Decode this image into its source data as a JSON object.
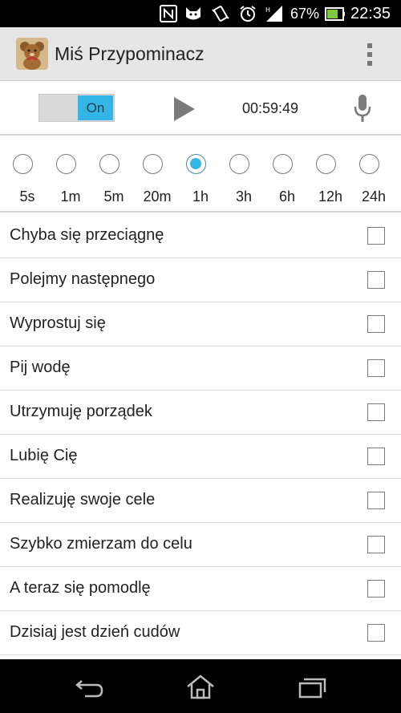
{
  "status_bar": {
    "battery_percent": "67%",
    "time": "22:35",
    "icons": [
      "nfc-icon",
      "cat-icon",
      "vibrate-icon",
      "alarm-icon",
      "signal-icon",
      "battery-icon"
    ]
  },
  "action_bar": {
    "title": "Miś Przypominacz",
    "app_icon": "teddy-bear-icon",
    "menu_icon": "overflow-menu-icon"
  },
  "controls": {
    "toggle_label": "On",
    "toggle_state": true,
    "timer": "00:59:49",
    "play_icon": "play-icon",
    "mic_icon": "microphone-icon"
  },
  "intervals": {
    "selected": "1h",
    "options": [
      {
        "label": "5s",
        "checked": false
      },
      {
        "label": "1m",
        "checked": false
      },
      {
        "label": "5m",
        "checked": false
      },
      {
        "label": "20m",
        "checked": false
      },
      {
        "label": "1h",
        "checked": true
      },
      {
        "label": "3h",
        "checked": false
      },
      {
        "label": "6h",
        "checked": false
      },
      {
        "label": "12h",
        "checked": false
      },
      {
        "label": "24h",
        "checked": false
      }
    ]
  },
  "reminders": [
    {
      "text": "Chyba się przeciągnę",
      "checked": false
    },
    {
      "text": "Polejmy następnego",
      "checked": false
    },
    {
      "text": "Wyprostuj się",
      "checked": false
    },
    {
      "text": "Pij wodę",
      "checked": false
    },
    {
      "text": "Utrzymuję porządek",
      "checked": false
    },
    {
      "text": "Lubię Cię",
      "checked": false
    },
    {
      "text": "Realizuję swoje cele",
      "checked": false
    },
    {
      "text": "Szybko zmierzam do celu",
      "checked": false
    },
    {
      "text": "A teraz się pomodlę",
      "checked": false
    },
    {
      "text": "Dzisiaj jest dzień cudów",
      "checked": false
    }
  ],
  "nav_bar": {
    "buttons": [
      "back-icon",
      "home-icon",
      "recent-apps-icon"
    ]
  },
  "colors": {
    "accent": "#33b5e5",
    "action_bar": "#e6e6e6",
    "status_bar": "#000000"
  }
}
